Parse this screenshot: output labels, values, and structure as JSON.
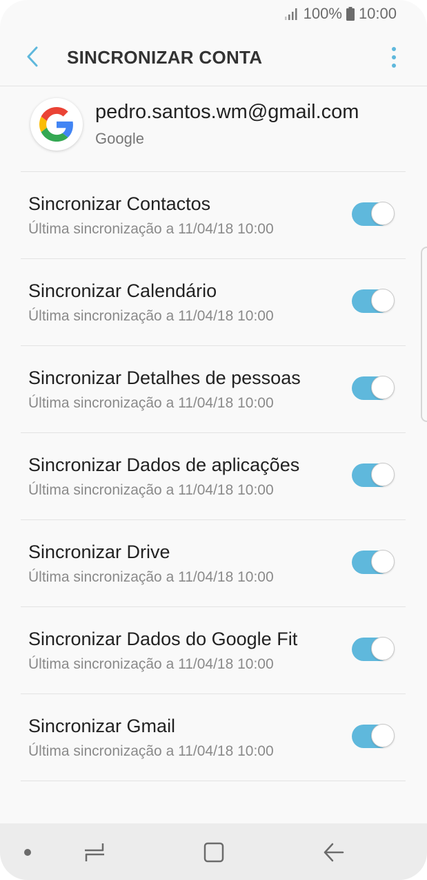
{
  "status_bar": {
    "battery_percent": "100%",
    "time": "10:00",
    "signal_icon": "signal-icon",
    "battery_icon": "battery-icon"
  },
  "app_bar": {
    "title": "SINCRONIZAR CONTA",
    "back_icon": "chevron-left-icon",
    "more_icon": "more-vertical-icon"
  },
  "account": {
    "email": "pedro.santos.wm@gmail.com",
    "type": "Google",
    "icon": "google-logo-icon"
  },
  "colors": {
    "accent": "#5fb8dc",
    "title_text": "#333333"
  },
  "sync_items": [
    {
      "label": "Sincronizar Contactos",
      "last_sync": "Última sincronização a 11/04/18  10:00",
      "enabled": true
    },
    {
      "label": "Sincronizar Calendário",
      "last_sync": "Última sincronização a 11/04/18  10:00",
      "enabled": true
    },
    {
      "label": "Sincronizar Detalhes de pessoas",
      "last_sync": "Última sincronização a 11/04/18  10:00",
      "enabled": true
    },
    {
      "label": "Sincronizar Dados de aplicações",
      "last_sync": "Última sincronização a 11/04/18  10:00",
      "enabled": true
    },
    {
      "label": "Sincronizar Drive",
      "last_sync": "Última sincronização a 11/04/18  10:00",
      "enabled": true
    },
    {
      "label": "Sincronizar Dados do Google Fit",
      "last_sync": "Última sincronização a 11/04/18  10:00",
      "enabled": true
    },
    {
      "label": "Sincronizar Gmail",
      "last_sync": "Última sincronização a 11/04/18  10:00",
      "enabled": true
    }
  ],
  "nav_bar": {
    "recents_icon": "recents-icon",
    "home_icon": "home-icon",
    "back_icon": "back-arrow-icon"
  }
}
